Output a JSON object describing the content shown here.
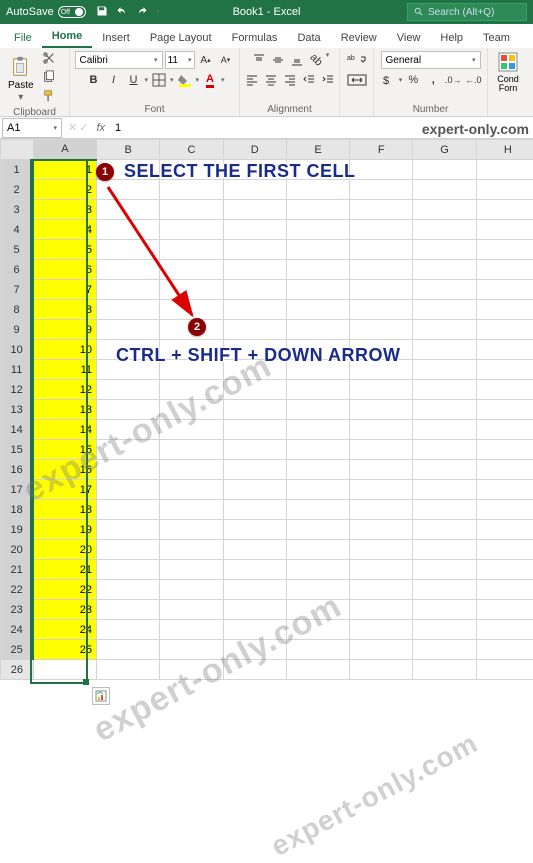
{
  "titlebar": {
    "autosave_label": "AutoSave",
    "toggle_state": "Off",
    "doc_title": "Book1 - Excel",
    "search_placeholder": "Search (Alt+Q)"
  },
  "tabs": {
    "file": "File",
    "home": "Home",
    "insert": "Insert",
    "page_layout": "Page Layout",
    "formulas": "Formulas",
    "data": "Data",
    "review": "Review",
    "view": "View",
    "help": "Help",
    "team": "Team"
  },
  "ribbon": {
    "clipboard": {
      "label": "Clipboard",
      "paste": "Paste"
    },
    "font": {
      "label": "Font",
      "name": "Calibri",
      "size": "11",
      "bold": "B",
      "italic": "I",
      "underline": "U"
    },
    "alignment": {
      "label": "Alignment"
    },
    "number": {
      "label": "Number",
      "format": "General"
    },
    "cond": {
      "label": "Cond Forn"
    }
  },
  "namebox": "A1",
  "formula_value": "1",
  "columns": [
    "A",
    "B",
    "C",
    "D",
    "E",
    "F",
    "G",
    "H"
  ],
  "rows": [
    1,
    2,
    3,
    4,
    5,
    6,
    7,
    8,
    9,
    10,
    11,
    12,
    13,
    14,
    15,
    16,
    17,
    18,
    19,
    20,
    21,
    22,
    23,
    24,
    25,
    26
  ],
  "cell_values": {
    "A1": "1",
    "A2": "2",
    "A3": "3",
    "A4": "4",
    "A5": "5",
    "A6": "6",
    "A7": "7",
    "A8": "8",
    "A9": "9",
    "A10": "10",
    "A11": "11",
    "A12": "12",
    "A13": "13",
    "A14": "14",
    "A15": "15",
    "A16": "16",
    "A17": "17",
    "A18": "18",
    "A19": "19",
    "A20": "20",
    "A21": "21",
    "A22": "22",
    "A23": "23",
    "A24": "24",
    "A25": "25"
  },
  "annotations": {
    "badge1": "1",
    "text1": "SELECT THE FIRST CELL",
    "badge2": "2",
    "text2": "CTRL + SHIFT + DOWN ARROW"
  },
  "watermark": "expert-only.com"
}
